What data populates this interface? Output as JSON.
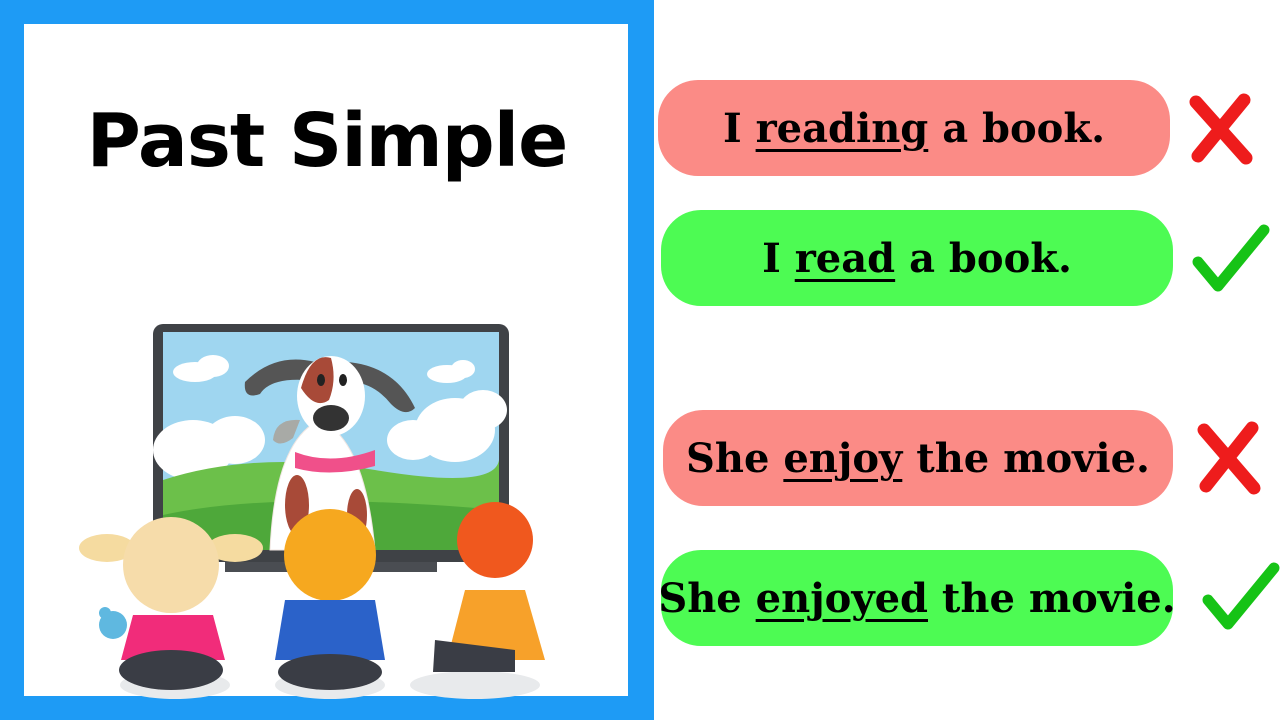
{
  "title": "Past Simple",
  "examples": [
    {
      "status": "incorrect",
      "before": "I ",
      "underlined": "reading",
      "after": " a book.",
      "mark_icon": "cross-mark-icon"
    },
    {
      "status": "correct",
      "before": "I ",
      "underlined": "read",
      "after": " a book.",
      "mark_icon": "check-mark-icon"
    },
    {
      "status": "incorrect",
      "before": "She ",
      "underlined": "enjoy",
      "after": " the movie.",
      "mark_icon": "cross-mark-icon"
    },
    {
      "status": "correct",
      "before": "She ",
      "underlined": "enjoyed",
      "after": " the movie.",
      "mark_icon": "check-mark-icon"
    }
  ],
  "colors": {
    "frame": "#1e9bf5",
    "incorrect_pill": "#fb8b86",
    "correct_pill": "#4dfb53",
    "cross": "#ee1c1c",
    "check": "#16c316"
  },
  "illustration": "children-watching-dog-on-tv"
}
